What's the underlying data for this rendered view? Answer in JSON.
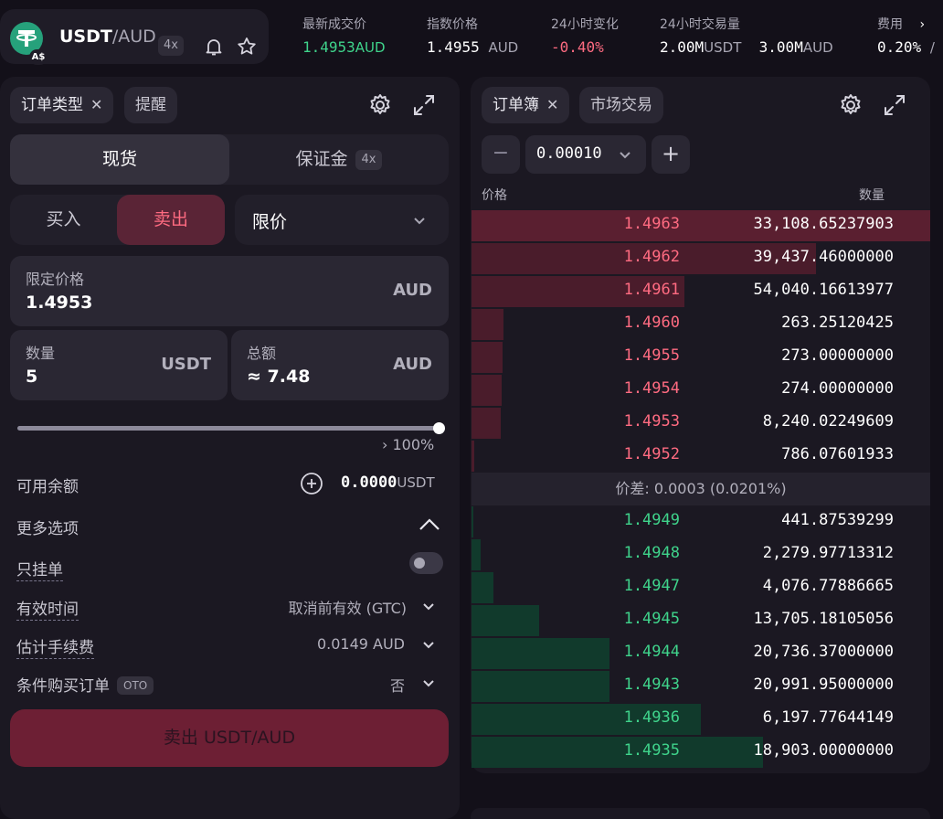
{
  "header": {
    "pair_base": "USDT",
    "pair_quote": "/AUD",
    "badge": "A$",
    "leverage": "4x",
    "stats": [
      {
        "label": "最新成交价",
        "value": "1.4953",
        "unit": "AUD",
        "color": "green"
      },
      {
        "label": "指数价格",
        "value": "1.4955",
        "unit": "AUD",
        "color": "white"
      },
      {
        "label": "24小时变化",
        "value": "-0.40%",
        "unit": "",
        "color": "red"
      },
      {
        "label": "24小时交易量",
        "value": "2.00M",
        "unit": "USDT",
        "value2": "3.00M",
        "unit2": "AUD",
        "color": "white"
      },
      {
        "label": "费用",
        "value": "0.20%",
        "unit": "/",
        "color": "white"
      }
    ]
  },
  "order_form": {
    "tab_order_type": "订单类型",
    "tab_alerts": "提醒",
    "mode_spot": "现货",
    "mode_margin": "保证金",
    "margin_leverage": "4x",
    "side_buy": "买入",
    "side_sell": "卖出",
    "order_kind": "限价",
    "limit_price_label": "限定价格",
    "limit_price_value": "1.4953",
    "limit_price_unit": "AUD",
    "quantity_label": "数量",
    "quantity_value": "5",
    "quantity_unit": "USDT",
    "total_label": "总额",
    "total_value": "≈ 7.48",
    "total_unit": "AUD",
    "slider_percent": "100%",
    "slider_fraction": 1.0,
    "available_label": "可用余额",
    "available_value": "0.0000",
    "available_unit": "USDT",
    "more_options_label": "更多选项",
    "post_only_label": "只挂单",
    "tif_label": "有效时间",
    "tif_value": "取消前有效 (GTC)",
    "fee_label": "估计手续费",
    "fee_value": "0.0149 AUD",
    "oto_label": "条件购买订单",
    "oto_chip": "OTO",
    "oto_value": "否",
    "submit_label": "卖出 USDT/AUD"
  },
  "order_book": {
    "tab_book": "订单簿",
    "tab_trades": "市场交易",
    "tick_size": "0.00010",
    "minus": "−",
    "plus": "+",
    "col_price": "价格",
    "col_qty": "数量",
    "spread_label": "价差: 0.0003 (0.0201%)",
    "asks": [
      {
        "price": "1.4963",
        "qty": "33,108.65237903",
        "depth": 1.0
      },
      {
        "price": "1.4962",
        "qty": "39,437.46000000",
        "depth": 0.75
      },
      {
        "price": "1.4961",
        "qty": "54,040.16613977",
        "depth": 0.465
      },
      {
        "price": "1.4960",
        "qty": "263.25120425",
        "depth": 0.07
      },
      {
        "price": "1.4955",
        "qty": "273.00000000",
        "depth": 0.068
      },
      {
        "price": "1.4954",
        "qty": "274.00000000",
        "depth": 0.066
      },
      {
        "price": "1.4953",
        "qty": "8,240.02249609",
        "depth": 0.064
      },
      {
        "price": "1.4952",
        "qty": "786.07601933",
        "depth": 0.006
      }
    ],
    "bids": [
      {
        "price": "1.4949",
        "qty": "441.87539299",
        "depth": 0.003
      },
      {
        "price": "1.4948",
        "qty": "2,279.97713312",
        "depth": 0.02
      },
      {
        "price": "1.4947",
        "qty": "4,076.77886665",
        "depth": 0.048
      },
      {
        "price": "1.4945",
        "qty": "13,705.18105056",
        "depth": 0.147
      },
      {
        "price": "1.4944",
        "qty": "20,736.37000000",
        "depth": 0.3
      },
      {
        "price": "1.4943",
        "qty": "20,991.95000000",
        "depth": 0.3
      },
      {
        "price": "1.4936",
        "qty": "6,197.77644149",
        "depth": 0.5
      },
      {
        "price": "1.4935",
        "qty": "18,903.00000000",
        "depth": 0.636
      }
    ]
  },
  "colors": {
    "ask_bar": "#4a1c2b",
    "ask_bar_top": "#5a1f30",
    "bid_bar": "#113a2c",
    "ask_text": "#ff6b81",
    "bid_text": "#3fd38b",
    "sell_button": "#6d1f34",
    "sell_tab": "#5a2436"
  }
}
